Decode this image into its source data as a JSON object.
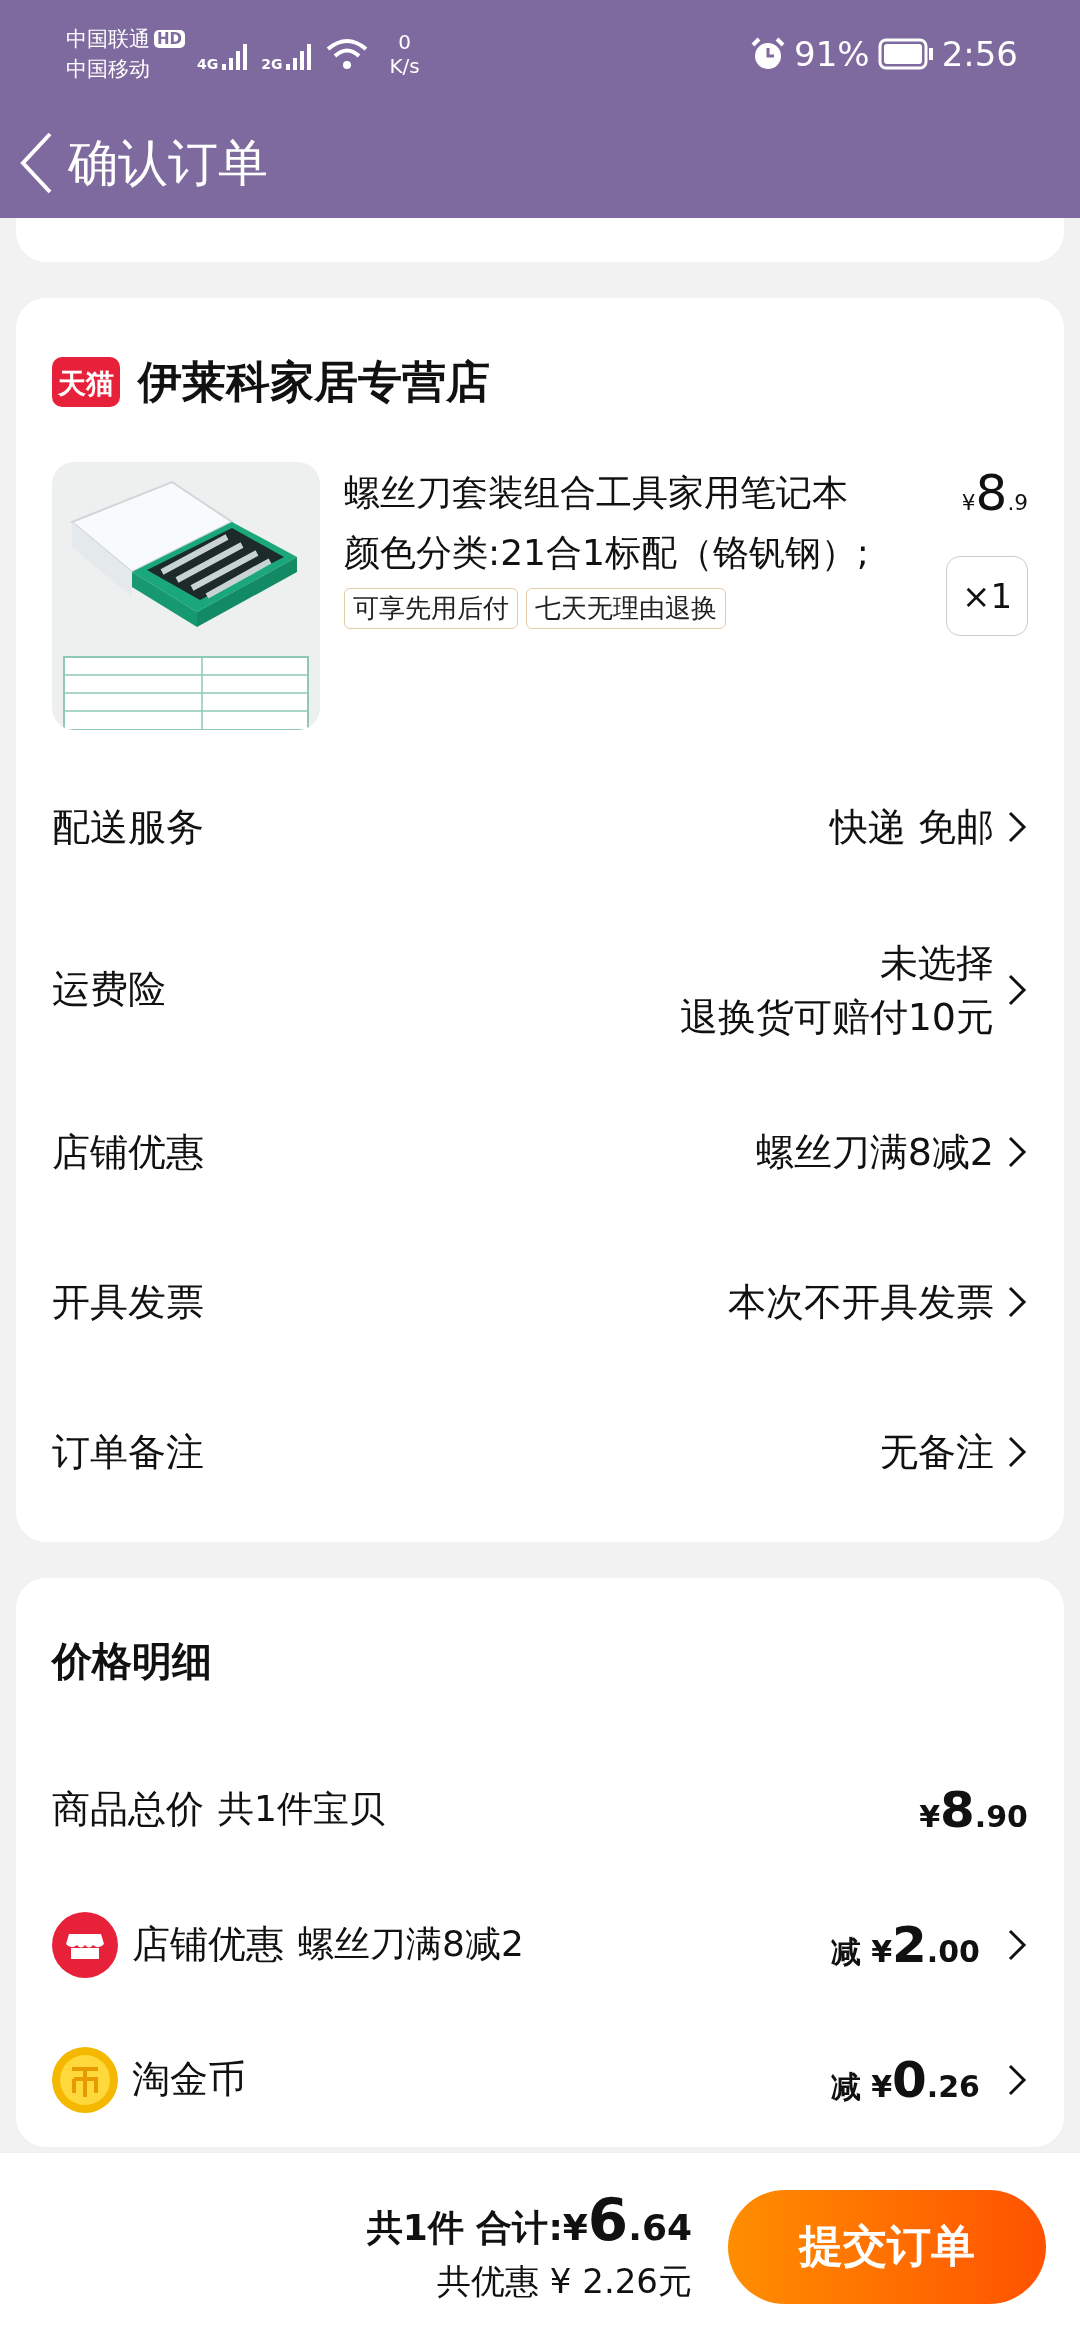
{
  "status_bar": {
    "carrier_1": "中国联通",
    "hd_badge": "HD",
    "network_1": "4G",
    "network_2": "2G",
    "carrier_2": "中国移动",
    "speed_value": "0",
    "speed_unit": "K/s",
    "battery": "91%",
    "time": "2:56"
  },
  "header": {
    "title": "确认订单"
  },
  "store": {
    "badge": "天猫",
    "name": "伊莱科家居专营店"
  },
  "product": {
    "image": {
      "kind": "picture"
    },
    "title": "螺丝刀套装组合工具家用笔记本",
    "variant": "颜色分类:21合1标配（铬钒钢）;",
    "tags": [
      "可享先用后付",
      "七天无理由退换"
    ],
    "price": {
      "currency": "¥",
      "main": "8",
      "fraction": ".9"
    },
    "quantity": "×1"
  },
  "order_rows": [
    {
      "label": "配送服务",
      "values": [
        "快递 免邮"
      ]
    },
    {
      "label": "运费险",
      "values": [
        "未选择",
        "退换货可赔付10元"
      ]
    },
    {
      "label": "店铺优惠",
      "values": [
        "螺丝刀满8减2"
      ]
    },
    {
      "label": "开具发票",
      "values": [
        "本次不开具发票"
      ]
    },
    {
      "label": "订单备注",
      "values": [
        "无备注"
      ]
    }
  ],
  "price_detail": {
    "title": "价格明细",
    "rows": [
      {
        "kind": "plain",
        "label": "商品总价",
        "note": "共1件宝贝",
        "amount": {
          "prefix": "¥",
          "main": "8",
          "fraction": ".90"
        },
        "has_arrow": false
      },
      {
        "kind": "store",
        "label": "店铺优惠",
        "note": "螺丝刀满8减2",
        "amount": {
          "prefix": "减 ¥",
          "main": "2",
          "fraction": ".00"
        },
        "has_arrow": true
      },
      {
        "kind": "coin",
        "label": "淘金币",
        "amount": {
          "prefix": "减 ¥",
          "main": "0",
          "fraction": ".26"
        },
        "has_arrow": true
      }
    ]
  },
  "footer": {
    "total": {
      "prefix": "共1件 合计:¥",
      "main": "6",
      "fraction": ".64"
    },
    "savings": "共优惠 ¥ 2.26元",
    "submit_button": "提交订单"
  }
}
